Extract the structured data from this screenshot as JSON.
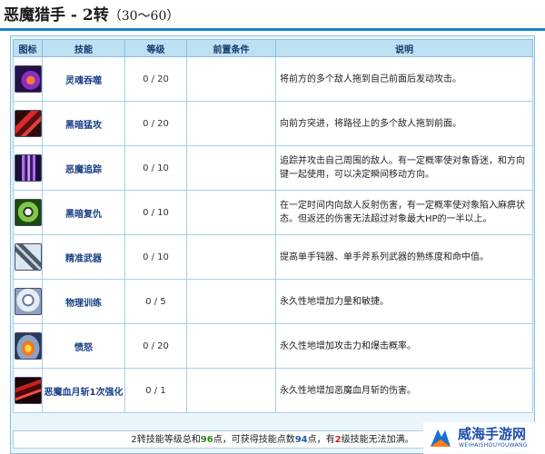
{
  "page": {
    "title": "恶魔猎手 - 2转",
    "level_range": "（30～60）"
  },
  "table": {
    "headers": {
      "icon": "图标",
      "skill": "技能",
      "level": "等级",
      "prerequisite": "前置条件",
      "description": "说明"
    },
    "rows": [
      {
        "icon": "soul-devour-skill-icon",
        "name": "灵魂吞噬",
        "level": "0 / 20",
        "prerequisite": "",
        "description": "将前方的多个敌人拖到自己前面后发动攻击。"
      },
      {
        "icon": "dark-charge-skill-icon",
        "name": "黑暗猛攻",
        "level": "0 / 20",
        "prerequisite": "",
        "description": "向前方突进，将路径上的多个敌人拖到前面。"
      },
      {
        "icon": "demon-pursuit-skill-icon",
        "name": "恶魔追踪",
        "level": "0 / 10",
        "prerequisite": "",
        "description": "追踪并攻击自己周围的敌人。有一定概率使对象昏迷，和方向键一起使用，可以决定瞬间移动方向。"
      },
      {
        "icon": "dark-revenge-skill-icon",
        "name": "黑暗复仇",
        "level": "0 / 10",
        "prerequisite": "",
        "description": "在一定时间内向敌人反射伤害，有一定概率使对象陷入麻痹状态。但返还的伤害无法超过对象最大HP的一半以上。"
      },
      {
        "icon": "precise-weapon-skill-icon",
        "name": "精准武器",
        "level": "0 / 10",
        "prerequisite": "",
        "description": "提高单手钝器、单手斧系列武器的熟练度和命中值。"
      },
      {
        "icon": "physical-training-skill-icon",
        "name": "物理训练",
        "level": "0 / 5",
        "prerequisite": "",
        "description": "永久性地增加力量和敏捷。"
      },
      {
        "icon": "fury-skill-icon",
        "name": "愤怒",
        "level": "0 / 20",
        "prerequisite": "",
        "description": "永久性地增加攻击力和爆击概率。"
      },
      {
        "icon": "demon-blood-moon-skill-icon",
        "name": "恶魔血月斩1次强化",
        "level": "0 / 1",
        "prerequisite": "",
        "description": "永久性地增加恶魔血月斩的伤害。"
      }
    ]
  },
  "footer": {
    "text_1": "2转技能等级总和",
    "total_points": "96",
    "text_2": "点，可获得技能点数",
    "available_points": "94",
    "text_3": "点，有",
    "locked_level": "2",
    "text_4": "级技能无法加满。"
  },
  "watermark": {
    "name": "威海手游网",
    "subtitle": "WEIHAISHOUYOUWANG"
  },
  "colors": {
    "accent": "#1c7fc0",
    "header_bg": "#bfe0f3",
    "panel_bg": "#eaf5fb",
    "skill_name": "#1a3f86",
    "footer_green": "#2f8a19",
    "footer_blue": "#1a5fb0",
    "footer_red": "#d02020"
  }
}
